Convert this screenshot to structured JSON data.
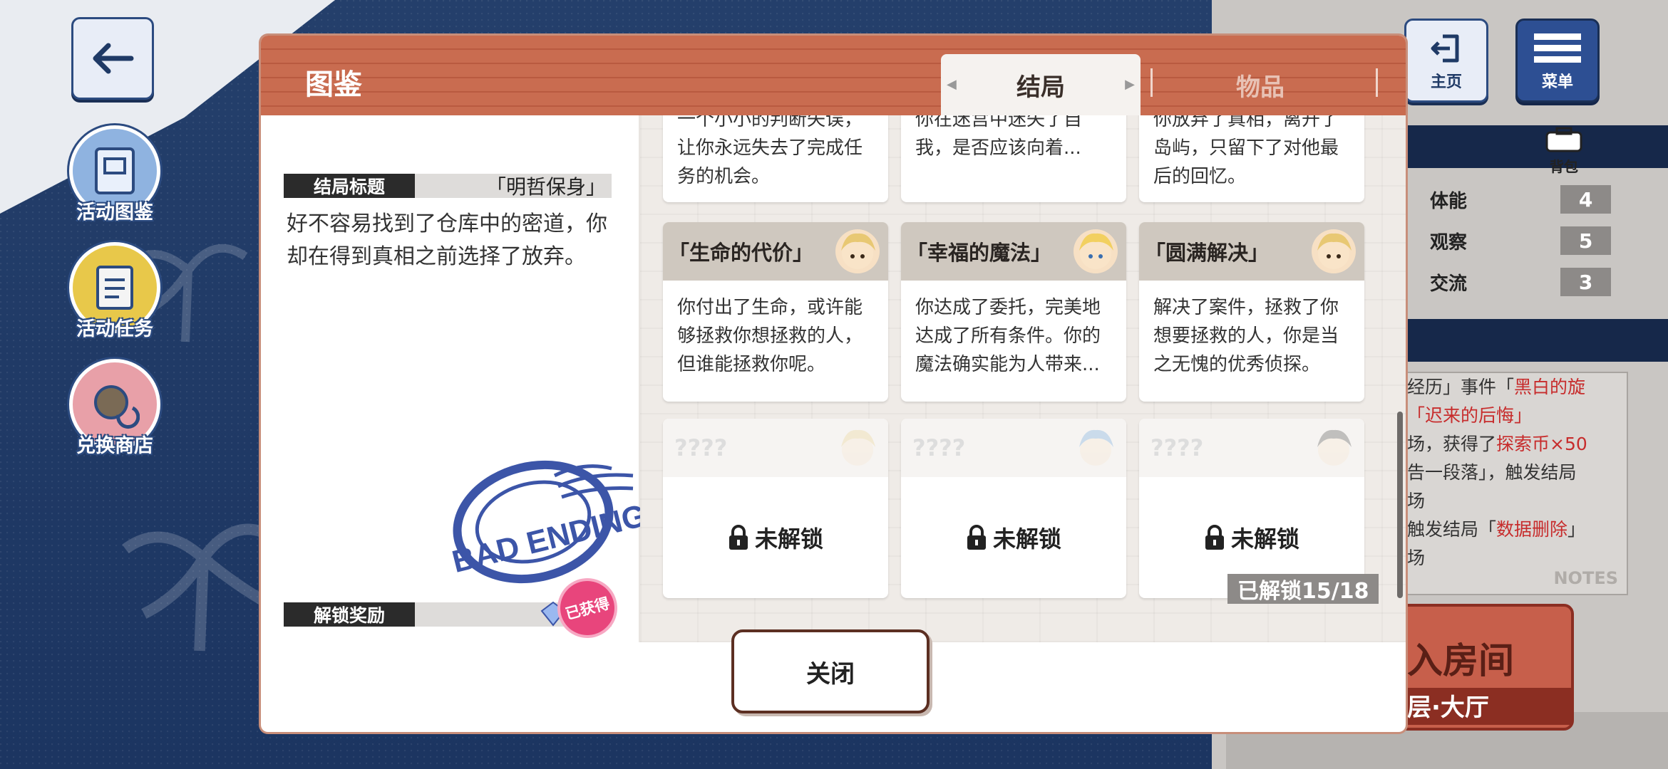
{
  "sidebar": {
    "activity_album": "活动图鉴",
    "activity_tasks": "活动任务",
    "exchange_shop": "兑换商店"
  },
  "top_right": {
    "home": "主页",
    "menu": "菜单",
    "backpack": "背包"
  },
  "stats": [
    {
      "name": "体能",
      "value": "4"
    },
    {
      "name": "观察",
      "value": "5"
    },
    {
      "name": "交流",
      "value": "3"
    }
  ],
  "notes": {
    "line1a": "经历」事件「",
    "line1b": "黑白的旋",
    "line2": "「迟来的后悔」",
    "line3a": "场，获得了",
    "line3b": "探索币×50",
    "line4": "告一段落」，触发结局",
    "line5": "场",
    "line6a": "触发结局「",
    "line6b": "数据删除",
    "line6c": "」",
    "line7": "场",
    "watermark": "NOTES"
  },
  "enter_room": {
    "title": "入房间",
    "sub": "层·大厅"
  },
  "dialog": {
    "title": "图鉴",
    "tabs": [
      {
        "label": "结局",
        "active": true
      },
      {
        "label": "物品",
        "active": false
      }
    ],
    "detail": {
      "ending_title_label": "结局标题",
      "ending_title_value": "「明哲保身」",
      "description": "好不容易找到了仓库中的密道，你却在得到真相之前选择了放弃。",
      "stamp_text": "BAD ENDING",
      "reward_label": "解锁奖励",
      "obtained": "已获得"
    },
    "cards_top": [
      {
        "text": "一个小小的判断失误，让你永远失去了完成任务的机会。"
      },
      {
        "text": "你在迷宫中迷失了自我，是否应该向着..."
      },
      {
        "text": "你放弃了真相，离开了岛屿，只留下了对他最后的回忆。"
      }
    ],
    "cards_mid": [
      {
        "title": "「生命的代价」",
        "text": "你付出了生命，或许能够拯救你想拯救的人，但谁能拯救你呢。"
      },
      {
        "title": "「幸福的魔法」",
        "text": "你达成了委托，完美地达成了所有条件。你的魔法确实能为人带来..."
      },
      {
        "title": "「圆满解决」",
        "text": "解决了案件，拯救了你想要拯救的人，你是当之无愧的优秀侦探。"
      }
    ],
    "cards_locked": [
      {
        "title": "????",
        "status": "未解锁"
      },
      {
        "title": "????",
        "status": "未解锁"
      },
      {
        "title": "????",
        "status": "未解锁"
      }
    ],
    "unlock_count": "已解锁15/18",
    "close": "关闭"
  },
  "colors": {
    "header": "#c96c50",
    "navy": "#2c4b80",
    "obtained_pink": "#e8457c"
  }
}
